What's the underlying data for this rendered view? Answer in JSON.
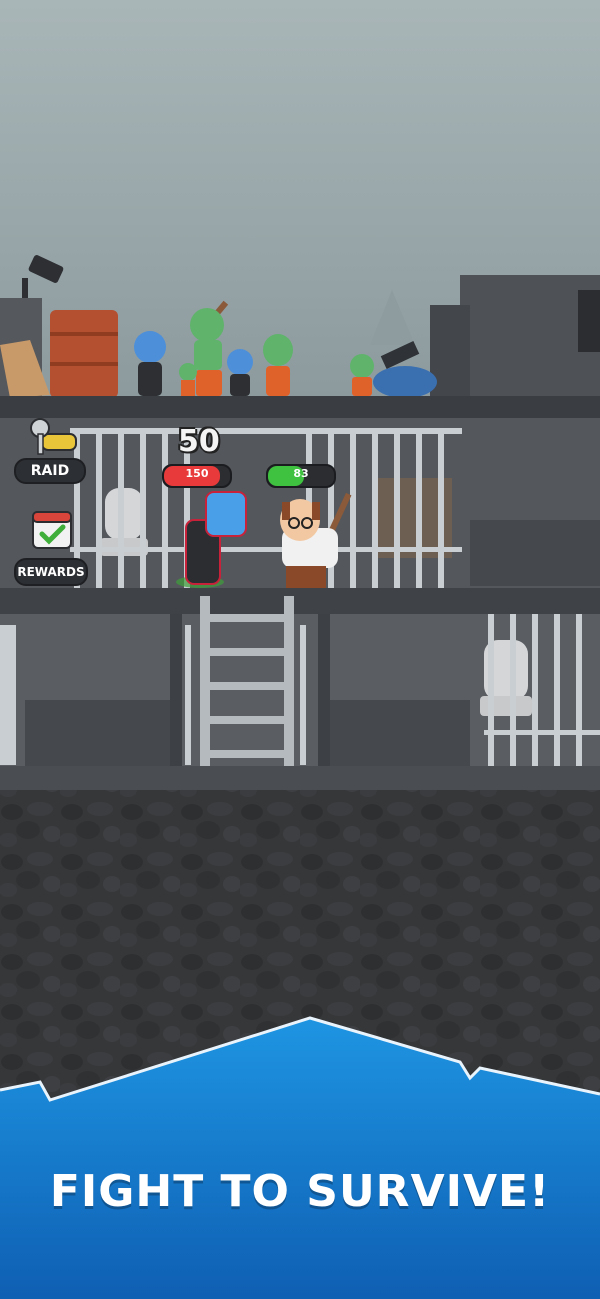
{
  "hud": {
    "raid_label": "RAID",
    "rewards_label": "REWARDS",
    "counter": "50"
  },
  "enemy": {
    "hp": "150",
    "hp_fraction": 0.85
  },
  "player": {
    "hp": "83",
    "hp_fraction": 0.55
  },
  "banner": {
    "text": "FIGHT TO SURVIVE!"
  },
  "colors": {
    "sky": "#9fadb0",
    "wall": "#4a4d52",
    "floor": "#3b3e43",
    "ground": "#36383b",
    "banner": "#1a86d6",
    "enemy_hp": "#e83a3a",
    "player_hp": "#3fc23f"
  },
  "icons": [
    "raid-car-key-icon",
    "rewards-calendar-check-icon"
  ]
}
